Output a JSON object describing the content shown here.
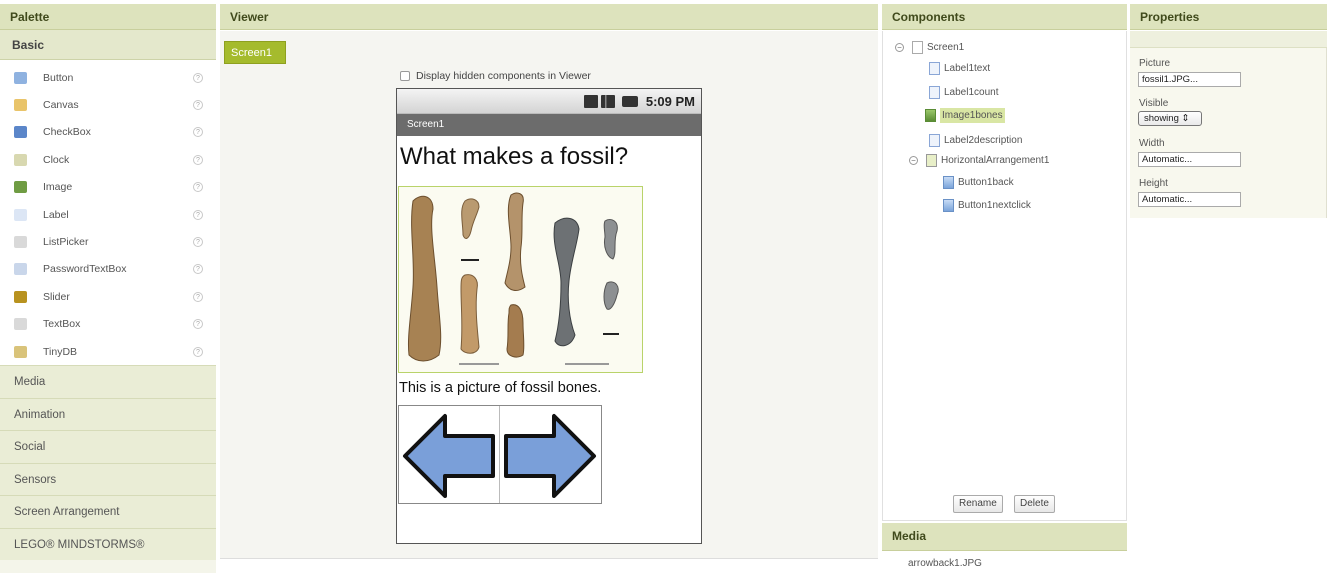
{
  "palette": {
    "title": "Palette",
    "basic_label": "Basic",
    "items": [
      {
        "label": "Button",
        "icon": "button-icon",
        "color": "#8fb2e0"
      },
      {
        "label": "Canvas",
        "icon": "canvas-icon",
        "color": "#e9c46a"
      },
      {
        "label": "CheckBox",
        "icon": "checkbox-icon",
        "color": "#5b86c9"
      },
      {
        "label": "Clock",
        "icon": "clock-icon",
        "color": "#d8d8b0"
      },
      {
        "label": "Image",
        "icon": "image-icon",
        "color": "#6f9c43"
      },
      {
        "label": "Label",
        "icon": "label-icon",
        "color": "#dce6f5"
      },
      {
        "label": "ListPicker",
        "icon": "listpicker-icon",
        "color": "#d9d9d9"
      },
      {
        "label": "PasswordTextBox",
        "icon": "password-icon",
        "color": "#c9d6ea"
      },
      {
        "label": "Slider",
        "icon": "slider-icon",
        "color": "#b8921f"
      },
      {
        "label": "TextBox",
        "icon": "textbox-icon",
        "color": "#d9d9d9"
      },
      {
        "label": "TinyDB",
        "icon": "tinydb-icon",
        "color": "#d9c37a"
      }
    ],
    "drawers": [
      "Media",
      "Animation",
      "Social",
      "Sensors",
      "Screen Arrangement",
      "LEGO® MINDSTORMS®"
    ]
  },
  "viewer": {
    "title": "Viewer",
    "screen_tab": "Screen1",
    "hidden_checkbox_label": "Display hidden components in Viewer",
    "phone": {
      "time": "5:09 PM",
      "screen_title": "Screen1",
      "heading": "What makes a fossil?",
      "description": "This is a picture of fossil bones."
    }
  },
  "components": {
    "title": "Components",
    "tree": {
      "screen": "Screen1",
      "label1": "Label1text",
      "label2": "Label1count",
      "image": "Image1bones",
      "label3": "Label2description",
      "arrangement": "HorizontalArrangement1",
      "button1": "Button1back",
      "button2": "Button1nextclick"
    },
    "rename_label": "Rename",
    "delete_label": "Delete"
  },
  "media": {
    "title": "Media",
    "file": "arrowback1.JPG"
  },
  "properties": {
    "title": "Properties",
    "picture_label": "Picture",
    "picture_value": "fossil1.JPG...",
    "visible_label": "Visible",
    "visible_value": "showing ⇕",
    "width_label": "Width",
    "width_value": "Automatic...",
    "height_label": "Height",
    "height_value": "Automatic..."
  },
  "colors": {
    "header_bg": "#dde3bd",
    "accent": "#a5bb2d",
    "selected": "#d9e6a4"
  }
}
